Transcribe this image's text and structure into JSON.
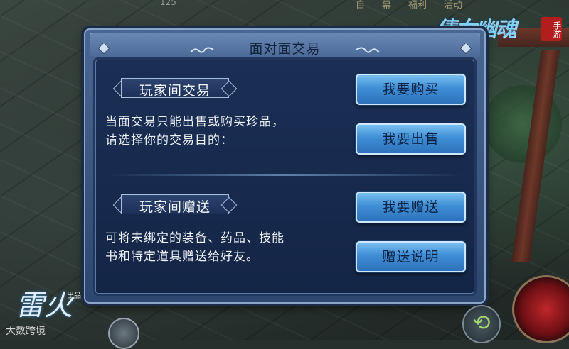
{
  "hud": {
    "top_menu": [
      "自",
      "幕",
      "福利",
      "活动"
    ],
    "top_number": "125",
    "game_logo_text": "倩女幽魂",
    "game_logo_seal": "手游",
    "publisher_logo_glyph": "雷火",
    "publisher_logo_sub": "出品",
    "watermark": "大数跨境"
  },
  "dialog": {
    "title": "面对面交易",
    "trade_section": {
      "banner": "玩家间交易",
      "description": [
        "当面交易只能出售或购买珍品，",
        "请选择你的交易目的："
      ],
      "buy_label": "我要购买",
      "sell_label": "我要出售"
    },
    "gift_section": {
      "banner": "玩家间赠送",
      "description": [
        "可将未绑定的装备、药品、技能",
        "书和特定道具赠送给好友。"
      ],
      "gift_label": "我要赠送",
      "gift_info_label": "赠送说明"
    }
  },
  "colors": {
    "dialog_frame": "#4a6793",
    "dialog_body": "#1b2f55",
    "button": "#3f8fd6",
    "button_text": "#0c2244"
  }
}
